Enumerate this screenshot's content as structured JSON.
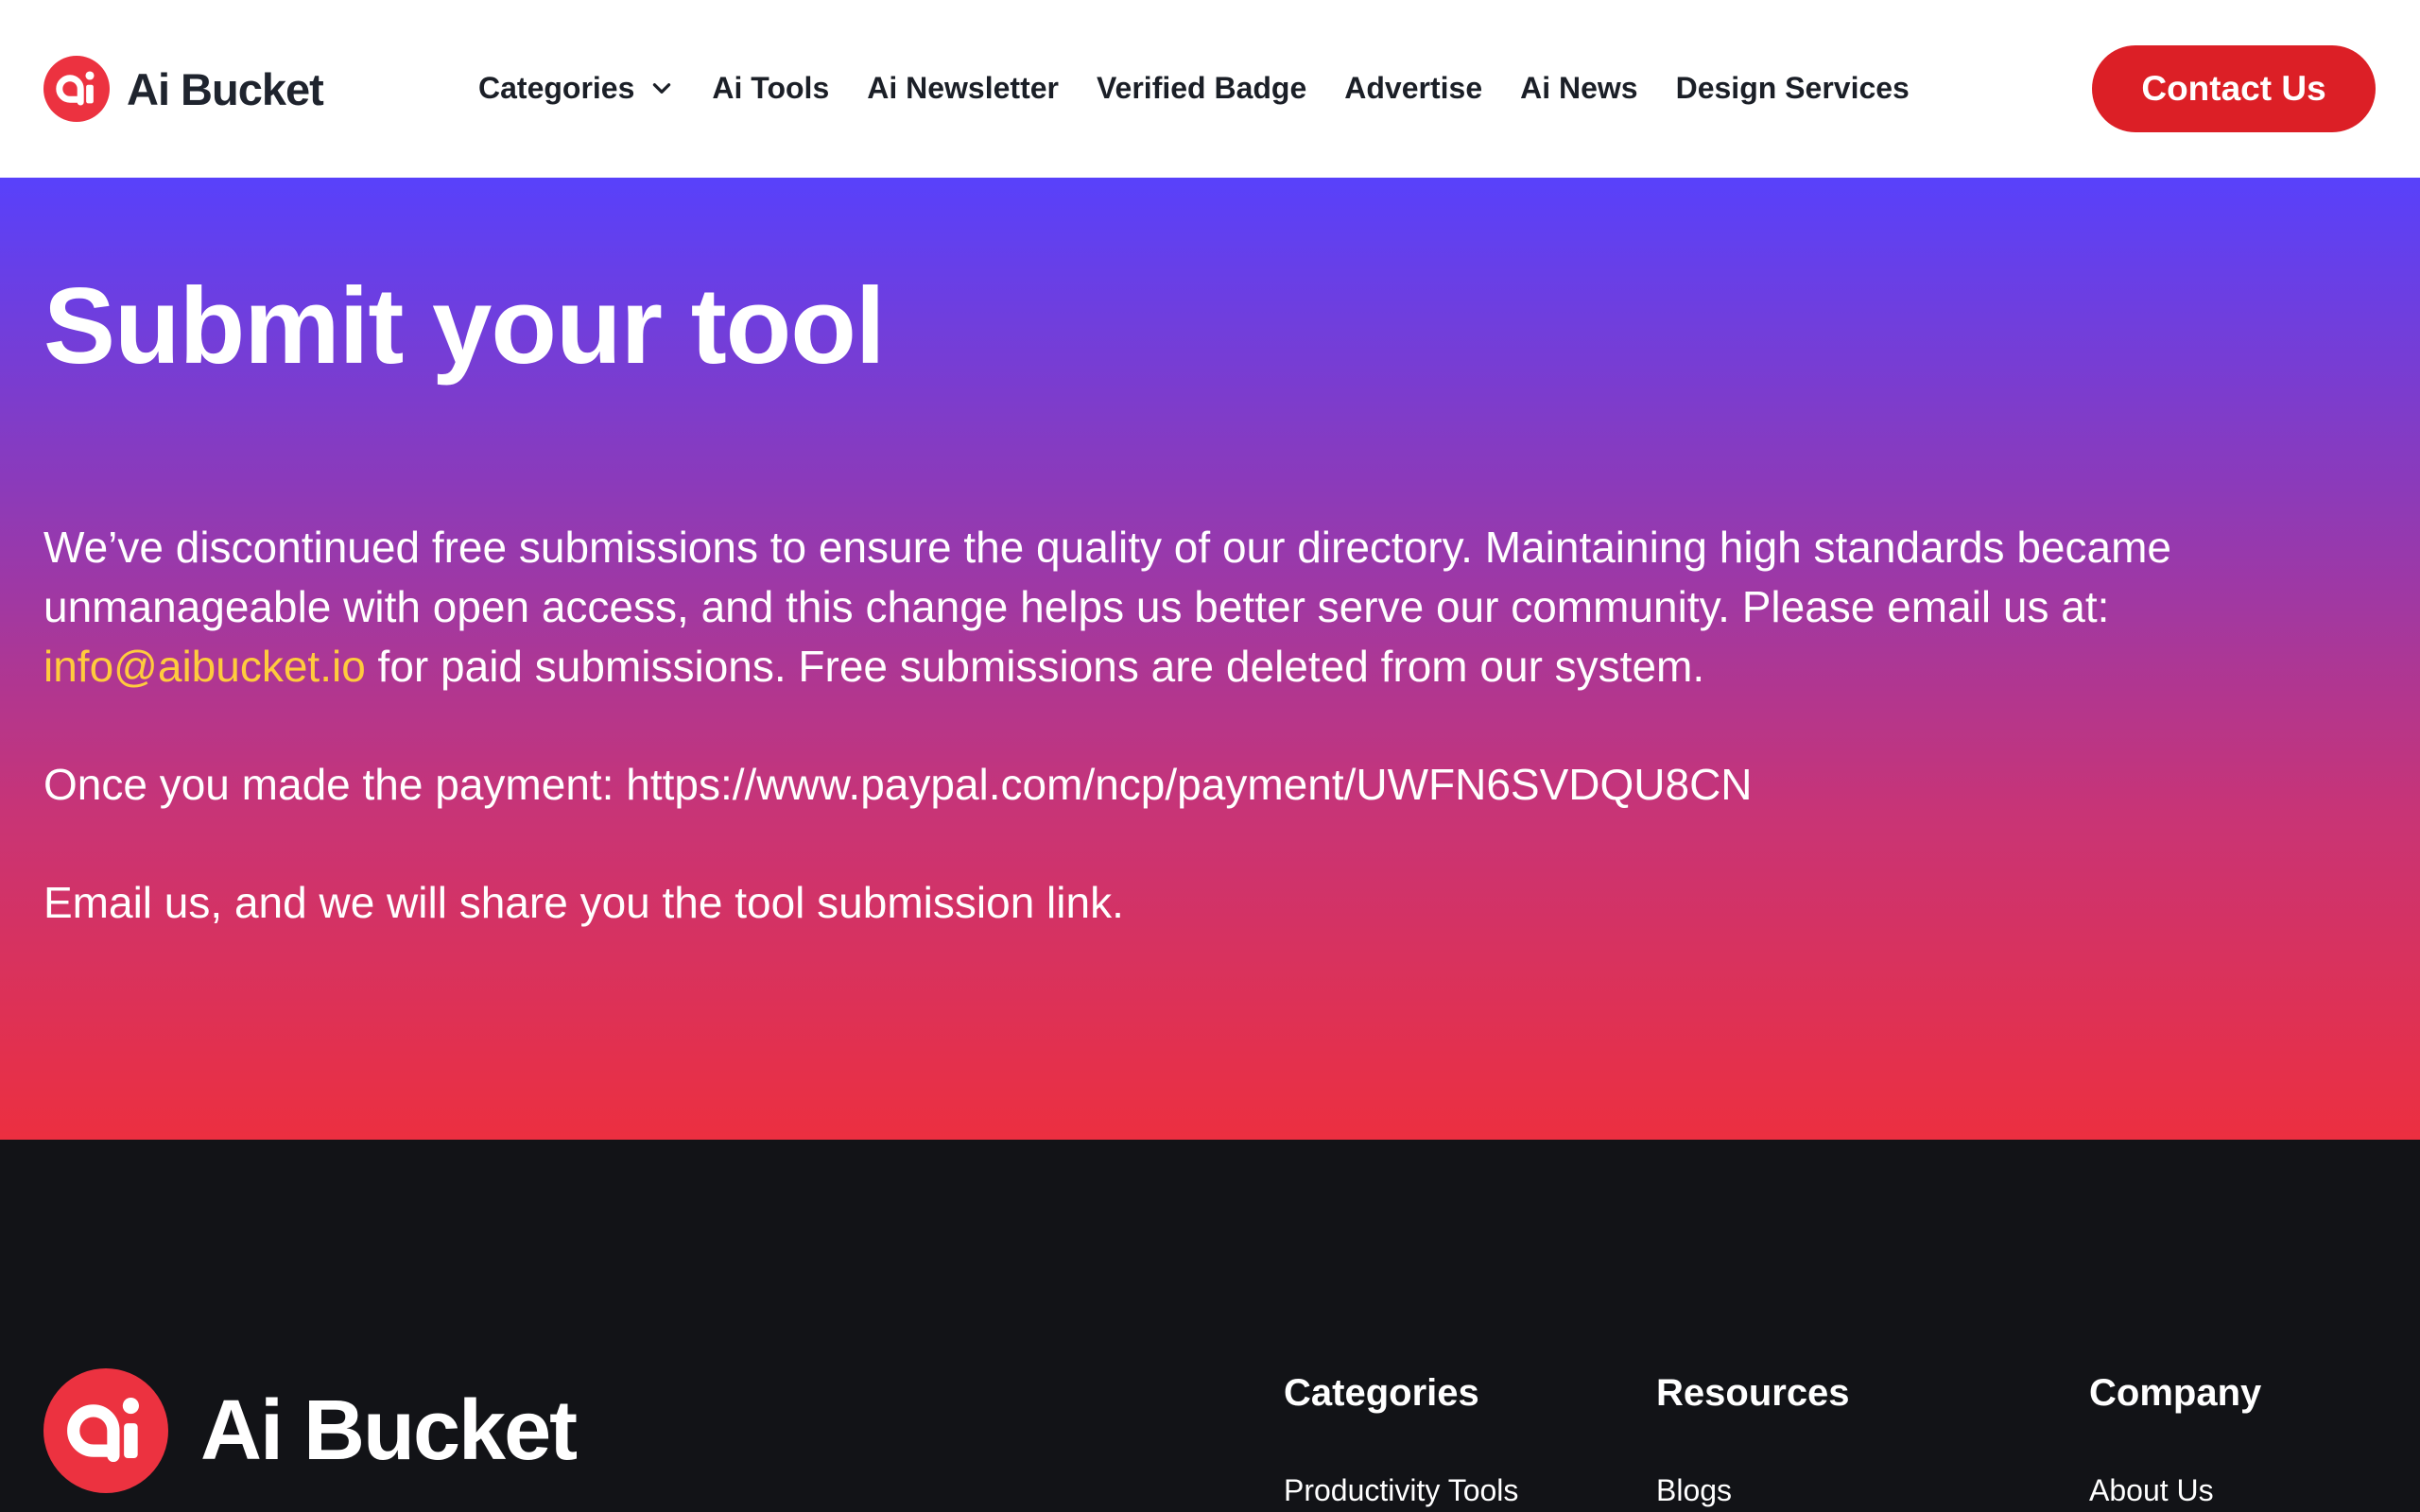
{
  "header": {
    "logo_text": "Ai Bucket",
    "nav": [
      {
        "label": "Categories"
      },
      {
        "label": "Ai Tools"
      },
      {
        "label": "Ai Newsletter"
      },
      {
        "label": "Verified Badge"
      },
      {
        "label": "Advertise"
      },
      {
        "label": "Ai News"
      },
      {
        "label": "Design Services"
      }
    ],
    "contact_label": "Contact Us"
  },
  "hero": {
    "title": "Submit your tool",
    "paragraph1_before": "We’ve discontinued free submissions to ensure the quality of our directory. Maintaining high standards became unmanageable with open access, and this change helps us better serve our community. Please email us at: ",
    "email": "info@aibucket.io",
    "paragraph1_after": " for paid submissions. Free submissions are deleted from our system.",
    "paragraph2": "Once you made the payment: https://www.paypal.com/ncp/payment/UWFN6SVDQU8CN",
    "paragraph3": "Email us, and we will share you the tool submission link."
  },
  "footer": {
    "logo_text": "Ai Bucket",
    "columns": [
      {
        "heading": "Categories",
        "first_link": "Productivity Tools"
      },
      {
        "heading": "Resources",
        "first_link": "Blogs"
      },
      {
        "heading": "Company",
        "first_link": "About Us"
      }
    ]
  },
  "colors": {
    "brand_red": "#dc1f26",
    "hero_gradient_top": "#5841fb",
    "hero_gradient_bottom": "#ec2f40",
    "email_link": "#ffcb3d",
    "footer_bg": "#121317"
  },
  "icons": {
    "logo": "ai-bucket-logo-icon",
    "dropdown": "chevron-down-icon"
  }
}
